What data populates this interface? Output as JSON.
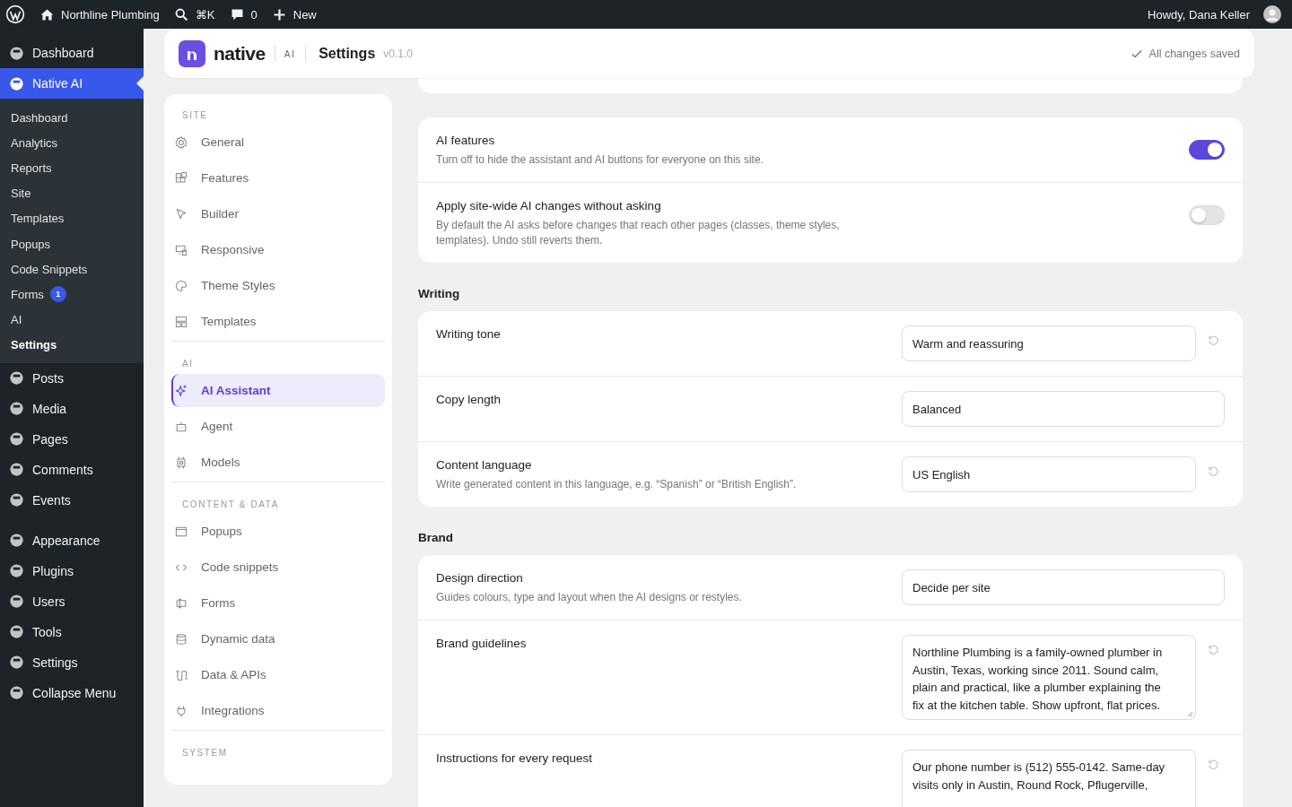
{
  "admin_bar": {
    "site_name": "Northline Plumbing",
    "search_shortcut": "⌘K",
    "comments_count": "0",
    "new_label": "New",
    "greeting": "Howdy, Dana Keller"
  },
  "admin_menu": {
    "groups": [
      {
        "items": [
          {
            "label": "Dashboard",
            "selected": false
          },
          {
            "label": "Native AI",
            "selected": true,
            "submenu": [
              {
                "label": "Dashboard",
                "selected": false
              },
              {
                "label": "Analytics",
                "selected": false
              },
              {
                "label": "Reports",
                "selected": false
              },
              {
                "label": "Site",
                "selected": false
              },
              {
                "label": "Templates",
                "selected": false
              },
              {
                "label": "Popups",
                "selected": false
              },
              {
                "label": "Code Snippets",
                "selected": false
              },
              {
                "label": "Forms",
                "selected": false,
                "badge": "1"
              },
              {
                "label": "AI",
                "selected": false
              },
              {
                "label": "Settings",
                "selected": true
              }
            ]
          },
          {
            "label": "Posts",
            "selected": false
          },
          {
            "label": "Media",
            "selected": false
          },
          {
            "label": "Pages",
            "selected": false
          },
          {
            "label": "Comments",
            "selected": false
          },
          {
            "label": "Events",
            "selected": false
          }
        ]
      },
      {
        "items": [
          {
            "label": "Appearance",
            "selected": false
          },
          {
            "label": "Plugins",
            "selected": false
          },
          {
            "label": "Users",
            "selected": false
          },
          {
            "label": "Tools",
            "selected": false
          },
          {
            "label": "Settings",
            "selected": false
          },
          {
            "label": "Collapse Menu",
            "selected": false
          }
        ]
      }
    ]
  },
  "header": {
    "brand": "native",
    "brand_tag": "AI",
    "title": "Settings",
    "version": "v0.1.0",
    "status": "All changes saved"
  },
  "settings_nav": [
    {
      "heading": "SITE",
      "items": [
        {
          "label": "General",
          "selected": false
        },
        {
          "label": "Features",
          "selected": false
        },
        {
          "label": "Builder",
          "selected": false
        },
        {
          "label": "Responsive",
          "selected": false
        },
        {
          "label": "Theme Styles",
          "selected": false
        },
        {
          "label": "Templates",
          "selected": false
        }
      ]
    },
    {
      "heading": "AI",
      "items": [
        {
          "label": "AI Assistant",
          "selected": true
        },
        {
          "label": "Agent",
          "selected": false
        },
        {
          "label": "Models",
          "selected": false
        }
      ]
    },
    {
      "heading": "CONTENT & DATA",
      "items": [
        {
          "label": "Popups",
          "selected": false
        },
        {
          "label": "Code snippets",
          "selected": false
        },
        {
          "label": "Forms",
          "selected": false
        },
        {
          "label": "Dynamic data",
          "selected": false
        },
        {
          "label": "Data & APIs",
          "selected": false
        },
        {
          "label": "Integrations",
          "selected": false
        }
      ]
    },
    {
      "heading": "SYSTEM"
    }
  ],
  "sections": [
    {
      "rows": [
        {
          "kind": "toggle",
          "label": "AI features",
          "description": "Turn off to hide the assistant and AI buttons for everyone on this site.",
          "on": true
        },
        {
          "kind": "toggle",
          "label": "Apply site-wide AI changes without asking",
          "description": "By default the AI asks before changes that reach other pages (classes, theme styles, templates). Undo still reverts them.",
          "on": false
        }
      ]
    },
    {
      "heading": "Writing",
      "rows": [
        {
          "kind": "field",
          "label": "Writing tone",
          "value": "Warm and reassuring",
          "reset": true
        },
        {
          "kind": "field",
          "label": "Copy length",
          "value": "Balanced",
          "reset": false
        },
        {
          "kind": "field",
          "label": "Content language",
          "description": "Write generated content in this language, e.g. “Spanish” or “British English”.",
          "value": "US English",
          "reset": true
        }
      ]
    },
    {
      "heading": "Brand",
      "rows": [
        {
          "kind": "field",
          "label": "Design direction",
          "description": "Guides colours, type and layout when the AI designs or restyles.",
          "value": "Decide per site",
          "reset": false
        },
        {
          "kind": "textarea",
          "label": "Brand guidelines",
          "value": "Northline Plumbing is a family-owned plumber in\nAustin, Texas, working since 2011. Sound calm,\nplain and practical, like a plumber explaining the\nfix at the kitchen table. Show upfront, flat prices.",
          "reset": true
        },
        {
          "kind": "textarea",
          "label": "Instructions for every request",
          "value": "Our phone number is (512) 555-0142. Same-day\nvisits only in Austin, Round Rock, Pflugerville,",
          "reset": true
        }
      ]
    }
  ]
}
